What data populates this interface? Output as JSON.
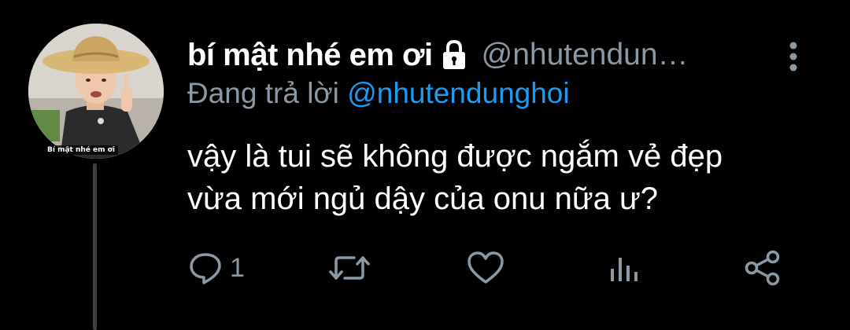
{
  "tweet": {
    "display_name": "bí mật nhé em ơi",
    "handle": "@nhutendun…",
    "reply_prefix": "Đang trả lời",
    "reply_to": "@nhutendunghoi",
    "text": "vậy là tui sẽ không được ngắm vẻ đẹp\nvừa mới ngủ dậy của onu nữa ư?",
    "avatar_caption": "Bí mật nhé em ơi",
    "protected_icon": "lock-icon",
    "more_icon": "vertical-ellipsis-icon"
  },
  "actions": {
    "reply": {
      "icon": "reply-icon",
      "count": "1"
    },
    "retweet": {
      "icon": "retweet-icon"
    },
    "like": {
      "icon": "heart-icon"
    },
    "analytics": {
      "icon": "analytics-icon"
    },
    "share": {
      "icon": "share-icon"
    }
  },
  "colors": {
    "background": "#000000",
    "text_primary": "#ffffff",
    "text_secondary": "#8b98a5",
    "mention": "#1d9bf0",
    "thread_line": "#3d4144"
  }
}
